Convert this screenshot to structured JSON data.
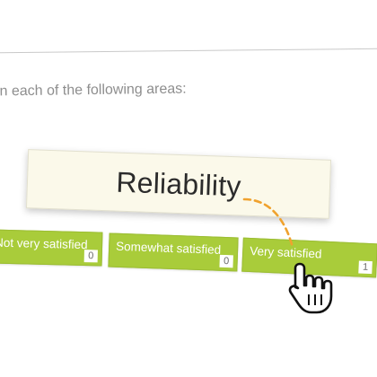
{
  "question": {
    "prompt": "in each of the following areas:"
  },
  "drag_item": {
    "label": "Reliability"
  },
  "options": [
    {
      "label": "Not very satisfied",
      "count": "0"
    },
    {
      "label": "Somewhat satisfied",
      "count": "0"
    },
    {
      "label": "Very satisfied",
      "count": "1"
    }
  ],
  "colors": {
    "option_green": "#a9cc3a",
    "card_bg": "#fbf9ea",
    "drag_path": "#f0a22e"
  },
  "cursor": {
    "icon": "hand-pointer-icon"
  }
}
